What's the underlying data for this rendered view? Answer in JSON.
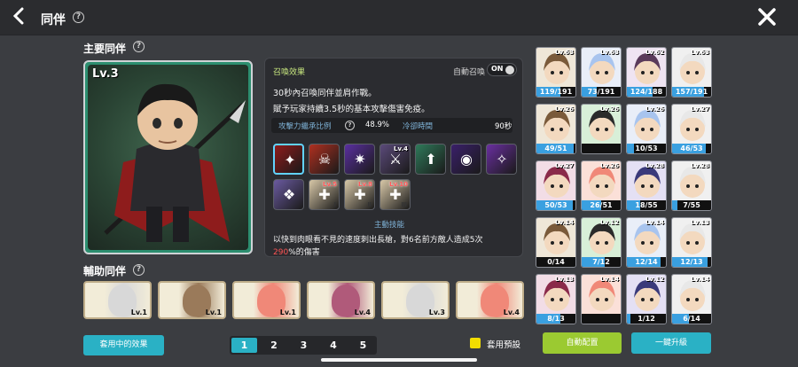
{
  "header": {
    "title": "同伴",
    "back_icon": "chevron-left-icon",
    "help_icon": "question-icon",
    "close_icon": "close-icon"
  },
  "main": {
    "label": "主要同伴",
    "level": "Lv.3",
    "summon_title": "召喚效果",
    "auto_summon_label": "自動召喚",
    "auto_summon_state": "ON",
    "desc_line1": "30秒內召喚同伴並肩作戰。",
    "desc_line2": "賦予玩家持續3.5秒的基本攻擊傷害免疫。",
    "stat_attack_label": "攻擊力繼承比例",
    "stat_attack_value": "48.9%",
    "stat_cooldown_label": "冷卻時間",
    "stat_cooldown_value": "90秒",
    "skills": [
      {
        "name": "skill-1",
        "level": "",
        "roman": "",
        "color": "#8e1b1b",
        "icon": "✦"
      },
      {
        "name": "skill-2",
        "level": "",
        "roman": "",
        "color": "#b03020",
        "icon": "☠"
      },
      {
        "name": "skill-3",
        "level": "",
        "roman": "",
        "color": "#5a2fa0",
        "icon": "✷"
      },
      {
        "name": "skill-4",
        "level": "Lv.4",
        "roman": "",
        "color": "#5b4a7a",
        "icon": "⚔"
      },
      {
        "name": "skill-5",
        "level": "",
        "roman": "",
        "color": "#2f7a5a",
        "icon": "⬆"
      },
      {
        "name": "skill-6",
        "level": "",
        "roman": "",
        "color": "#3a1f6a",
        "icon": "◉"
      },
      {
        "name": "skill-7",
        "level": "",
        "roman": "",
        "color": "#6a2fa0",
        "icon": "✧"
      },
      {
        "name": "skill-8",
        "level": "",
        "roman": "",
        "color": "#6a5aa0",
        "icon": "❖"
      },
      {
        "name": "skill-9",
        "level": "Lv.5",
        "roman": "Ⅰ",
        "color": "#d8c8a8",
        "icon": "✚"
      },
      {
        "name": "skill-10",
        "level": "Lv.8",
        "roman": "Ⅱ",
        "color": "#d8c8a8",
        "icon": "✚"
      },
      {
        "name": "skill-11",
        "level": "Lv.10",
        "roman": "Ⅲ",
        "color": "#d8c8a8",
        "icon": "✚"
      }
    ],
    "active_skill_label": "主動技能",
    "active_desc_line1": "以快到肉眼看不見的速度刺出長槍，對6名前方敵人造成5次",
    "active_desc_pct": "290",
    "active_desc_line2_tail": "%的傷害"
  },
  "sub": {
    "label": "輔助同伴",
    "cards": [
      {
        "level": "Lv.1",
        "color": "#d8d8d8"
      },
      {
        "level": "Lv.1",
        "color": "#9a7a5a"
      },
      {
        "level": "Lv.1",
        "color": "#f08878"
      },
      {
        "level": "Lv.4",
        "color": "#b05a7a"
      },
      {
        "level": "Lv.3",
        "color": "#d8d8d8"
      },
      {
        "level": "Lv.4",
        "color": "#f08878"
      }
    ]
  },
  "grid": [
    {
      "level": "Lv.63",
      "count": "119/191",
      "pct": 0.62,
      "bg": "#efe7d8",
      "hair": "#7a5a3a"
    },
    {
      "level": "Lv.63",
      "count": "73/191",
      "pct": 0.38,
      "bg": "#e9eef8",
      "hair": "#a8c4ee"
    },
    {
      "level": "Lv.62",
      "count": "124/188",
      "pct": 0.66,
      "bg": "#efe4f2",
      "hair": "#5a3a5a"
    },
    {
      "level": "Lv.63",
      "count": "157/191",
      "pct": 0.82,
      "bg": "#f0f0f0",
      "hair": "#e8e8e8"
    },
    {
      "level": "Lv.26",
      "count": "49/51",
      "pct": 0.96,
      "bg": "#efe7d8",
      "hair": "#7a5a3a"
    },
    {
      "level": "Lv.26",
      "count": "",
      "pct": 0,
      "bg": "#d8efd8",
      "hair": "#2a2a2a"
    },
    {
      "level": "Lv.26",
      "count": "10/53",
      "pct": 0.19,
      "bg": "#e9eef8",
      "hair": "#a8c4ee"
    },
    {
      "level": "Lv.27",
      "count": "46/53",
      "pct": 0.87,
      "bg": "#f0f0f0",
      "hair": "#e8e8e8"
    },
    {
      "level": "Lv.27",
      "count": "50/53",
      "pct": 0.94,
      "bg": "#f2dde6",
      "hair": "#8a2a4a"
    },
    {
      "level": "Lv.26",
      "count": "26/51",
      "pct": 0.51,
      "bg": "#fbe0d8",
      "hair": "#f08878"
    },
    {
      "level": "Lv.28",
      "count": "18/55",
      "pct": 0.33,
      "bg": "#e4e0f4",
      "hair": "#3a3a7a"
    },
    {
      "level": "Lv.28",
      "count": "7/55",
      "pct": 0.13,
      "bg": "#f0f0f0",
      "hair": "#e8e8e8"
    },
    {
      "level": "Lv.14",
      "count": "0/14",
      "pct": 0.0,
      "bg": "#efe7d8",
      "hair": "#7a5a3a"
    },
    {
      "level": "Lv.12",
      "count": "7/12",
      "pct": 0.58,
      "bg": "#d8efd8",
      "hair": "#2a2a2a"
    },
    {
      "level": "Lv.14",
      "count": "12/14",
      "pct": 0.86,
      "bg": "#e9eef8",
      "hair": "#a8c4ee"
    },
    {
      "level": "Lv.13",
      "count": "12/13",
      "pct": 0.92,
      "bg": "#f0f0f0",
      "hair": "#e8e8e8"
    },
    {
      "level": "Lv.13",
      "count": "8/13",
      "pct": 0.62,
      "bg": "#f2dde6",
      "hair": "#8a2a4a"
    },
    {
      "level": "Lv.14",
      "count": "",
      "pct": 0,
      "bg": "#fbe0d8",
      "hair": "#f08878"
    },
    {
      "level": "Lv.12",
      "count": "1/12",
      "pct": 0.08,
      "bg": "#e4e0f4",
      "hair": "#3a3a7a"
    },
    {
      "level": "Lv.14",
      "count": "6/14",
      "pct": 0.43,
      "bg": "#f0f0f0",
      "hair": "#e8e8e8"
    }
  ],
  "footer": {
    "effect_button": "套用中的效果",
    "pages": [
      "1",
      "2",
      "3",
      "4",
      "5"
    ],
    "active_page": 0,
    "preset_label": "套用預設",
    "auto_config_button": "自動配置",
    "upgrade_button": "一鍵升級"
  }
}
